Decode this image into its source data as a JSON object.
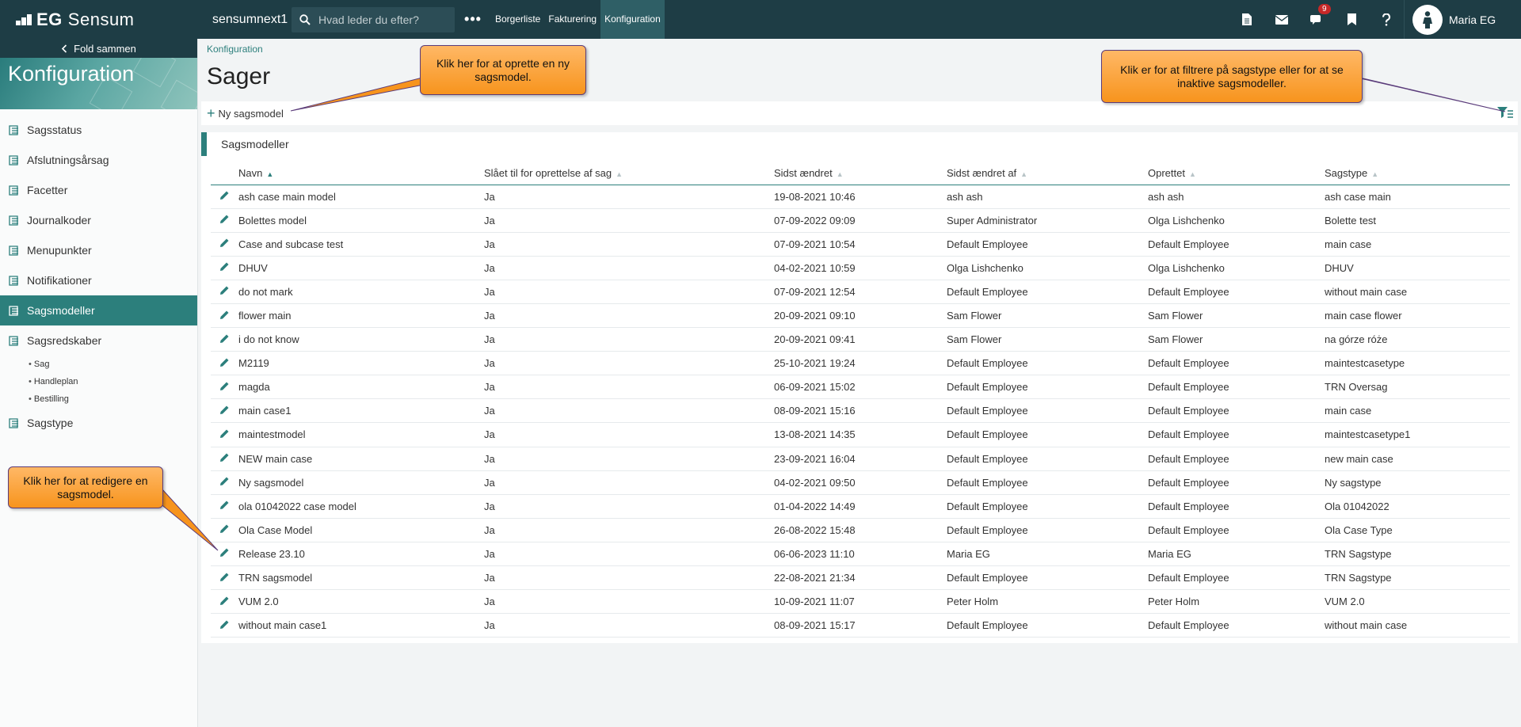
{
  "topbar": {
    "logo_bold": "EG",
    "logo_text": "Sensum",
    "environment": "sensumnext1",
    "search_placeholder": "Hvad leder du efter?",
    "more_label": "•••",
    "nav": [
      {
        "label": "Borgerliste",
        "active": false
      },
      {
        "label": "Fakturering",
        "active": false
      },
      {
        "label": "Konfiguration",
        "active": true
      }
    ],
    "icons": [
      "document-icon",
      "mail-icon",
      "chat-icon",
      "bookmark-icon",
      "help-icon"
    ],
    "chat_badge": "9",
    "user_name": "Maria EG"
  },
  "sidebar": {
    "collapse_label": "Fold sammen",
    "title": "Konfiguration",
    "items": [
      {
        "label": "Sagsstatus"
      },
      {
        "label": "Afslutningsårsag"
      },
      {
        "label": "Facetter"
      },
      {
        "label": "Journalkoder"
      },
      {
        "label": "Menupunkter"
      },
      {
        "label": "Notifikationer"
      },
      {
        "label": "Sagsmodeller"
      },
      {
        "label": "Sagsredskaber"
      }
    ],
    "sub_items": [
      "Sag",
      "Handleplan",
      "Bestilling"
    ],
    "last_item": "Sagstype"
  },
  "main": {
    "breadcrumb": "Konfiguration",
    "title": "Sager",
    "new_button": "Ny sagsmodel",
    "panel_title": "Sagsmodeller",
    "columns": [
      "Navn",
      "Slået til for oprettelse af sag",
      "Sidst ændret",
      "Sidst ændret af",
      "Oprettet",
      "Sagstype"
    ],
    "rows": [
      [
        "ash case main model",
        "Ja",
        "19-08-2021 10:46",
        "ash ash",
        "ash ash",
        "ash case main"
      ],
      [
        "Bolettes model",
        "Ja",
        "07-09-2022 09:09",
        "Super Administrator",
        "Olga Lishchenko",
        "Bolette test"
      ],
      [
        "Case and subcase test",
        "Ja",
        "07-09-2021 10:54",
        "Default Employee",
        "Default Employee",
        "main case"
      ],
      [
        "DHUV",
        "Ja",
        "04-02-2021 10:59",
        "Olga Lishchenko",
        "Olga Lishchenko",
        "DHUV"
      ],
      [
        "do not mark",
        "Ja",
        "07-09-2021 12:54",
        "Default Employee",
        "Default Employee",
        "without main case"
      ],
      [
        "flower main",
        "Ja",
        "20-09-2021 09:10",
        "Sam Flower",
        "Sam Flower",
        "main case flower"
      ],
      [
        "i do not know",
        "Ja",
        "20-09-2021 09:41",
        "Sam Flower",
        "Sam Flower",
        "na górze róże"
      ],
      [
        "M2119",
        "Ja",
        "25-10-2021 19:24",
        "Default Employee",
        "Default Employee",
        "maintestcasetype"
      ],
      [
        "magda",
        "Ja",
        "06-09-2021 15:02",
        "Default Employee",
        "Default Employee",
        "TRN Oversag"
      ],
      [
        "main case1",
        "Ja",
        "08-09-2021 15:16",
        "Default Employee",
        "Default Employee",
        "main case"
      ],
      [
        "maintestmodel",
        "Ja",
        "13-08-2021 14:35",
        "Default Employee",
        "Default Employee",
        "maintestcasetype1"
      ],
      [
        "NEW main case",
        "Ja",
        "23-09-2021 16:04",
        "Default Employee",
        "Default Employee",
        "new main case"
      ],
      [
        "Ny sagsmodel",
        "Ja",
        "04-02-2021 09:50",
        "Default Employee",
        "Default Employee",
        "Ny sagstype"
      ],
      [
        "ola 01042022 case model",
        "Ja",
        "01-04-2022 14:49",
        "Default Employee",
        "Default Employee",
        "Ola 01042022"
      ],
      [
        "Ola Case Model",
        "Ja",
        "26-08-2022 15:48",
        "Default Employee",
        "Default Employee",
        "Ola Case Type"
      ],
      [
        "Release 23.10",
        "Ja",
        "06-06-2023 11:10",
        "Maria EG",
        "Maria EG",
        "TRN Sagstype"
      ],
      [
        "TRN sagsmodel",
        "Ja",
        "22-08-2021 21:34",
        "Default Employee",
        "Default Employee",
        "TRN Sagstype"
      ],
      [
        "VUM 2.0",
        "Ja",
        "10-09-2021 11:07",
        "Peter Holm",
        "Peter Holm",
        "VUM 2.0"
      ],
      [
        "without main case1",
        "Ja",
        "08-09-2021 15:17",
        "Default Employee",
        "Default Employee",
        "without main case"
      ]
    ]
  },
  "callouts": {
    "new_model": "Klik her for at oprette en ny sagsmodel.",
    "filter": "Klik er for at filtrere på sagstype eller for at se inaktive sagsmodeller.",
    "edit": "Klik her for at redigere en sagsmodel."
  },
  "colors": {
    "topbar": "#1e3d45",
    "accent": "#2c7f7c",
    "callout": "#f7941d"
  }
}
